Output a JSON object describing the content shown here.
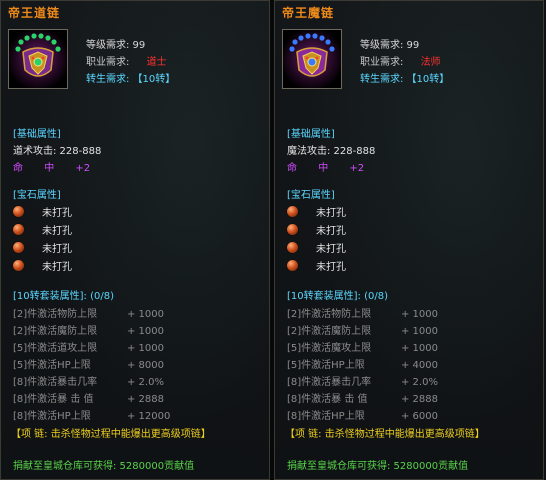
{
  "items": [
    {
      "name": "帝王道链",
      "level_req": "等级需求: 99",
      "job_req_label": "职业需求:",
      "job_req_value": "道士",
      "rebirth_req": "转生需求: 【10转】",
      "base_section": "[基础属性]",
      "base_attack": "道术攻击: 228-888",
      "special_attrs": [
        "命",
        "中",
        "+2"
      ],
      "gem_section": "[宝石属性]",
      "gems": [
        "未打孔",
        "未打孔",
        "未打孔",
        "未打孔"
      ],
      "set_section": "[10转套装属性]: (0/8)",
      "set_attrs": [
        {
          "name": "[2]件激活物防上限",
          "value": "+ 1000"
        },
        {
          "name": "[2]件激活魔防上限",
          "value": "+ 1000"
        },
        {
          "name": "[5]件激活道攻上限",
          "value": "+ 1000"
        },
        {
          "name": "[5]件激活HP上限",
          "value": "+ 8000"
        },
        {
          "name": "[8]件激活暴击几率",
          "value": "+ 2.0%"
        },
        {
          "name": "[8]件激活暴  击 值",
          "value": "+ 2888"
        },
        {
          "name": "[8]件激活HP上限",
          "value": "+ 12000"
        }
      ],
      "necklace_note": "【项  链: 击杀怪物过程中能爆出更高级项链】",
      "donate_text": "捐献至皇城仓库可获得: 5280000贡献值"
    },
    {
      "name": "帝王魔链",
      "level_req": "等级需求: 99",
      "job_req_label": "职业需求:",
      "job_req_value": "法师",
      "rebirth_req": "转生需求: 【10转】",
      "base_section": "[基础属性]",
      "base_attack": "魔法攻击: 228-888",
      "special_attrs": [
        "命",
        "中",
        "+2"
      ],
      "gem_section": "[宝石属性]",
      "gems": [
        "未打孔",
        "未打孔",
        "未打孔",
        "未打孔"
      ],
      "set_section": "[10转套装属性]: (0/8)",
      "set_attrs": [
        {
          "name": "[2]件激活物防上限",
          "value": "+ 1000"
        },
        {
          "name": "[2]件激活魔防上限",
          "value": "+ 1000"
        },
        {
          "name": "[5]件激活魔攻上限",
          "value": "+ 1000"
        },
        {
          "name": "[5]件激活HP上限",
          "value": "+ 4000"
        },
        {
          "name": "[8]件激活暴击几率",
          "value": "+ 2.0%"
        },
        {
          "name": "[8]件激活暴  击 值",
          "value": "+ 2888"
        },
        {
          "name": "[8]件激活HP上限",
          "value": "+ 6000"
        }
      ],
      "necklace_note": "【项  链: 击杀怪物过程中能爆出更高级项链】",
      "donate_text": "捐献至皇城仓库可获得: 5280000贡献值"
    }
  ],
  "colors": {
    "title": "#f08a1a",
    "section": "#5ad6ff",
    "job_red": "#ff3030",
    "special": "#d04aff",
    "set_gray": "#8a8a8a",
    "necklace": "#f0d020",
    "donate": "#58d24a"
  },
  "icons": [
    "necklace-dragon-icon-green",
    "necklace-dragon-icon-blue",
    "gem-socket-icon"
  ]
}
